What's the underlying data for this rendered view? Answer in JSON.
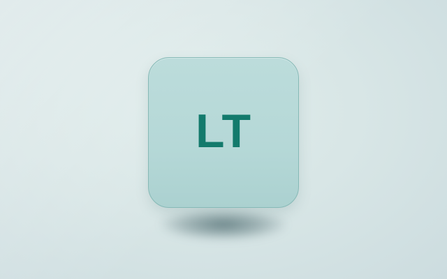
{
  "app_icon": {
    "label": "LT",
    "icon_name": "app-icon",
    "colors": {
      "label": "#137a6c",
      "fill": "#b8dad9",
      "border": "#86b9b6",
      "background": "#d8e6e6"
    }
  }
}
